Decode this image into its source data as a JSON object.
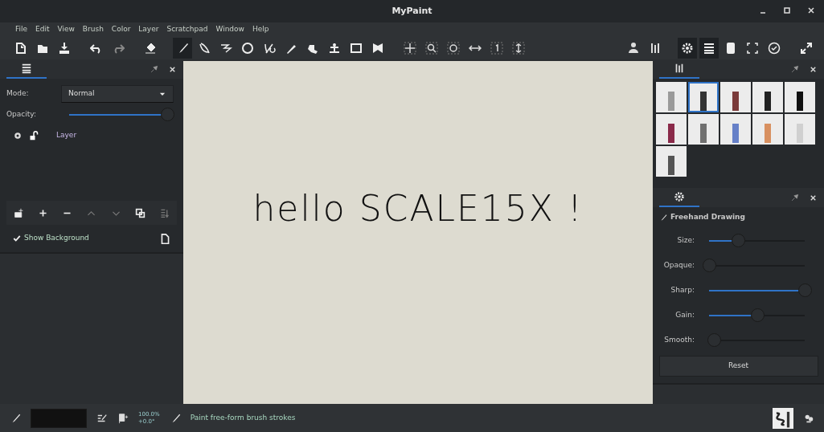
{
  "window": {
    "title": "MyPaint"
  },
  "menu": [
    "File",
    "Edit",
    "View",
    "Brush",
    "Color",
    "Layer",
    "Scratchpad",
    "Window",
    "Help"
  ],
  "toolbar": [
    {
      "selected": false
    },
    {
      "selected": false
    },
    {
      "selected": false
    },
    {
      "selected": false
    },
    {
      "selected": false
    },
    {
      "selected": false
    },
    {
      "selected": true
    },
    {
      "selected": false
    },
    {
      "selected": false
    },
    {
      "selected": false
    },
    {
      "selected": false
    },
    {
      "selected": false
    },
    {
      "selected": false
    },
    {
      "selected": false
    },
    {
      "selected": false
    },
    {
      "selected": false
    },
    {
      "selected": false
    },
    {
      "selected": false
    },
    {
      "selected": false
    },
    {
      "selected": false
    },
    {
      "selected": false
    },
    {
      "selected": false
    },
    {
      "selected": false
    },
    {
      "selected": false
    },
    {
      "selected": true
    },
    {
      "selected": true
    },
    {
      "selected": false
    },
    {
      "selected": false
    },
    {
      "selected": false
    },
    {
      "selected": false
    }
  ],
  "layers_panel": {
    "mode_label": "Mode:",
    "mode_value": "Normal",
    "opacity": {
      "label": "Opacity:",
      "level": 1.0
    },
    "layers": [
      {
        "name": "Layer",
        "visible": true,
        "locked": false
      }
    ],
    "show_background": {
      "label": "Show Background",
      "checked": true
    }
  },
  "canvas": {
    "drawing_text": "hello SCALE15X !"
  },
  "brushes": [
    {
      "selected": false
    },
    {
      "selected": true
    },
    {
      "selected": false
    },
    {
      "selected": false
    },
    {
      "selected": false
    },
    {
      "selected": false
    },
    {
      "selected": false
    },
    {
      "selected": false
    },
    {
      "selected": false
    },
    {
      "selected": false
    },
    {
      "selected": false
    }
  ],
  "tool_options": {
    "title": "Freehand Drawing",
    "sliders": [
      {
        "label": "Size:",
        "level": 0.3
      },
      {
        "label": "Opaque:",
        "level": 0.0
      },
      {
        "label": "Sharp:",
        "level": 1.0
      },
      {
        "label": "Gain:",
        "level": 0.5
      },
      {
        "label": "Smooth:",
        "level": 0.05
      }
    ],
    "reset": "Reset"
  },
  "status_bar": {
    "zoom": "100.0%",
    "rotation": "+0.0°",
    "message": "Paint free-form brush strokes"
  }
}
